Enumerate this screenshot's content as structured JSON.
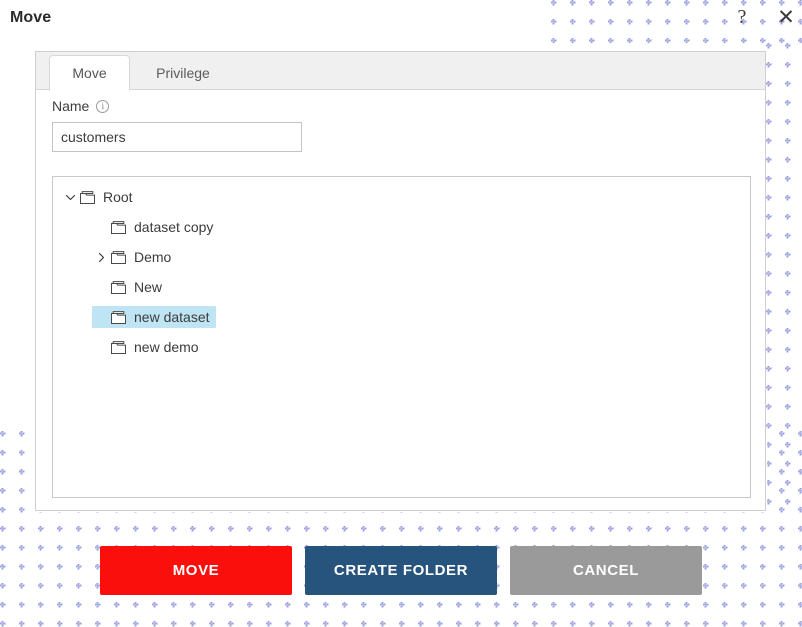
{
  "window": {
    "title": "Move",
    "help_icon": "question-mark-icon",
    "help_glyph": "?",
    "close_icon": "close-icon",
    "close_glyph": "✕"
  },
  "tabs": [
    {
      "label": "Move",
      "active": true
    },
    {
      "label": "Privilege",
      "active": false
    }
  ],
  "form": {
    "name_label": "Name",
    "info_icon": "info-icon",
    "info_glyph": "i",
    "name_value": "customers",
    "name_placeholder": ""
  },
  "tree": {
    "nodes": [
      {
        "label": "Root",
        "depth": 0,
        "expanded": true,
        "has_children": true,
        "selected": false,
        "icon": "folder-icon"
      },
      {
        "label": "dataset copy",
        "depth": 1,
        "expanded": false,
        "has_children": false,
        "selected": false,
        "icon": "folder-icon"
      },
      {
        "label": "Demo",
        "depth": 1,
        "expanded": false,
        "has_children": true,
        "selected": false,
        "icon": "folder-icon"
      },
      {
        "label": "New",
        "depth": 1,
        "expanded": false,
        "has_children": false,
        "selected": false,
        "icon": "folder-icon"
      },
      {
        "label": "new dataset",
        "depth": 1,
        "expanded": false,
        "has_children": false,
        "selected": true,
        "icon": "folder-icon"
      },
      {
        "label": "new demo",
        "depth": 1,
        "expanded": false,
        "has_children": false,
        "selected": false,
        "icon": "folder-icon"
      }
    ]
  },
  "footer": {
    "move_label": "MOVE",
    "create_folder_label": "CREATE FOLDER",
    "cancel_label": "CANCEL"
  },
  "colors": {
    "move_button": "#FA0F0C",
    "create_folder_button": "#26547C",
    "cancel_button": "#9A9A9A",
    "selected_row": "#BFE5F5",
    "tab_strip": "#F0F0F0",
    "dot_pattern": "#9AA0DF"
  }
}
